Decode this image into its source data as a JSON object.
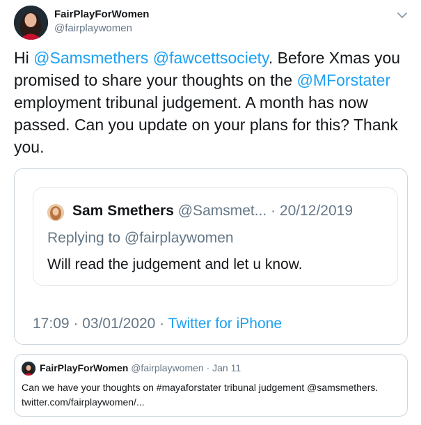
{
  "tweet": {
    "author_name": "FairPlayForWomen",
    "author_handle": "@fairplaywomen",
    "text_segments": [
      {
        "text": "Hi ",
        "type": "text"
      },
      {
        "text": "@Samsmethers",
        "type": "mention"
      },
      {
        "text": " ",
        "type": "text"
      },
      {
        "text": "@fawcettsociety",
        "type": "mention"
      },
      {
        "text": ". Before Xmas you promised to share your thoughts on the ",
        "type": "text"
      },
      {
        "text": "@MForstater",
        "type": "mention"
      },
      {
        "text": " employment tribunal judgement. A month has now passed. Can you update on your plans for this? Thank you.",
        "type": "text"
      }
    ]
  },
  "quoted": {
    "inner": {
      "name": "Sam Smethers",
      "meta": " @Samsmet... · 20/12/2019",
      "replying": "Replying to @fairplaywomen",
      "text": "Will read the judgement and let u know."
    },
    "time_date": "17:09 · 03/01/2020 · ",
    "source": "Twitter for iPhone"
  },
  "quote_tweet": {
    "name": "FairPlayForWomen",
    "meta": " @fairplaywomen · Jan 11",
    "text": "Can we have your thoughts on #mayaforstater tribunal judgement @samsmethers. twitter.com/fairplaywomen/..."
  },
  "colors": {
    "link": "#1da1f2",
    "secondary_text": "#657786",
    "primary_text": "#14171a",
    "border": "#ccd6dd"
  },
  "icons": {
    "menu": "chevron-down-icon"
  }
}
